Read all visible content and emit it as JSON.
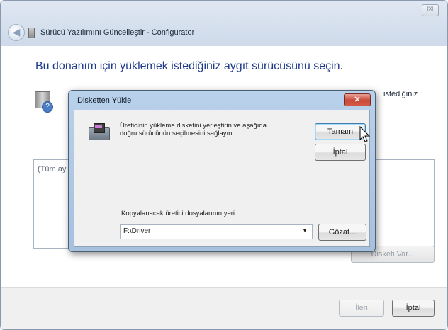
{
  "wizard": {
    "title": "Sürücü Yazılımını Güncelleştir - Configurator",
    "close_glyph": "☒",
    "back_glyph": "◀",
    "heading": "Bu donanım için yüklemek istediğiniz aygıt sürücüsünü seçin.",
    "right_truncated_text": "istediğiniz",
    "list_item_truncated": "(Tüm ay",
    "have_disk_label": "Disketi Var...",
    "next_label": "İleri",
    "cancel_label": "İptal"
  },
  "dialog": {
    "title": "Disketten Yükle",
    "close_glyph": "✕",
    "instruction": "Üreticinin yükleme disketini yerleştirin ve aşağıda doğru sürücünün seçilmesini sağlayın.",
    "ok_label": "Tamam",
    "cancel_label": "İptal",
    "location_label": "Kopyalanacak üretici dosyalarının yeri:",
    "location_value": "F:\\Driver",
    "dropdown_glyph": "▼",
    "browse_label": "Gözat..."
  },
  "icons": [
    "back-arrow-icon",
    "app-icon",
    "hardware-help-icon",
    "floppy-disk-icon",
    "mouse-cursor-icon"
  ]
}
